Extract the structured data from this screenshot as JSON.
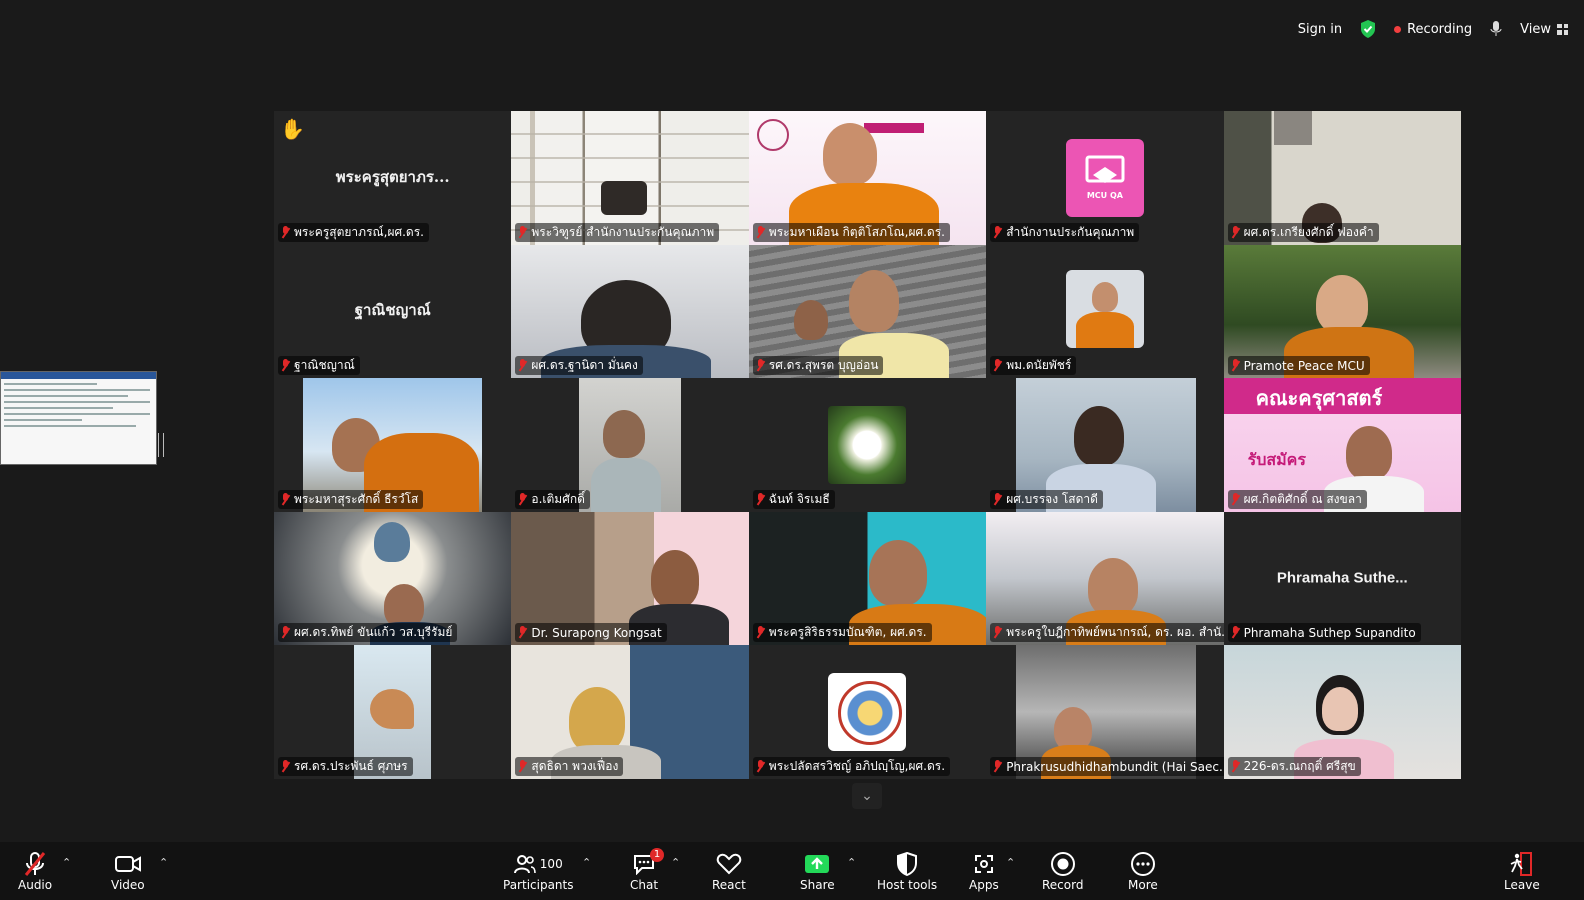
{
  "topbar": {
    "sign_in": "Sign in",
    "recording": "Recording",
    "view": "View"
  },
  "tiles": [
    {
      "label": "พระครูสุตยาภรณ์,ผศ.ดร.",
      "display_name": "พระครูสุตยาภร...",
      "raised_hand": true
    },
    {
      "label": "พระวิฑูรย์ สำนักงานประกันคุณภาพ"
    },
    {
      "label": "พระมหาเผือน กิตฺติโสภโณ,ผศ.ดร.",
      "speaking": true
    },
    {
      "label": "สำนักงานประกันคุณภาพ",
      "logo_text": "MCU QA"
    },
    {
      "label": "ผศ.ดร.เกรียงศักดิ์ ฟองคำ"
    },
    {
      "label": "ฐาณิชญาณ์",
      "display_name": "ฐาณิชญาณ์"
    },
    {
      "label": "ผศ.ดร.ฐานิดา มั่นคง"
    },
    {
      "label": "รศ.ดร.สุพรต บุญอ่อน"
    },
    {
      "label": "พม.ดนัยพัชร์"
    },
    {
      "label": "Pramote  Peace  MCU"
    },
    {
      "label": "พระมหาสุระศักดิ์ ธีรวํโส"
    },
    {
      "label": "อ.เติมศักดิ์"
    },
    {
      "label": "ฉันท์ จิรเมธี"
    },
    {
      "label": "ผศ.บรรจง โสดาดี"
    },
    {
      "label": "ผศ.กิตติศักดิ์ ณ สงขลา",
      "banner": "คณะครุศาสตร์",
      "banner_sub": "รับสมัคร"
    },
    {
      "label": "ผศ.ดร.ทิพย์ ขันแก้ว วส.บุรีรัมย์"
    },
    {
      "label": "Dr. Surapong Kongsat"
    },
    {
      "label": "พระครูสิริธรรมบัณฑิต, ผศ.ดร."
    },
    {
      "label": "พระครูใบฎีกาทิพย์พนากรณ์, ดร. ผอ. สำนั...",
      "hilite": true
    },
    {
      "label": "Phramaha Suthep Supandito",
      "display_name": "Phramaha  Suthe..."
    },
    {
      "label": "รศ.ดร.ประพันธ์ ศุภษร"
    },
    {
      "label": "สุดธิดา พวงเฟื่อง"
    },
    {
      "label": "พระปลัดสรวิชญ์ อภิปญฺโญ,ผศ.ดร."
    },
    {
      "label": "Phrakrusudhidhambundit (Hai Saec..."
    },
    {
      "label": "226-ดร.ณกฤติ์ ศรีสุข"
    }
  ],
  "toolbar": {
    "audio": "Audio",
    "video": "Video",
    "participants": "Participants",
    "participants_count": "100",
    "chat": "Chat",
    "chat_badge": "1",
    "react": "React",
    "share": "Share",
    "host_tools": "Host tools",
    "apps": "Apps",
    "record": "Record",
    "more": "More",
    "leave": "Leave"
  },
  "colors": {
    "speaking": "#23d959",
    "muted": "#e02828",
    "share": "#23d959",
    "leave": "#e02828"
  }
}
